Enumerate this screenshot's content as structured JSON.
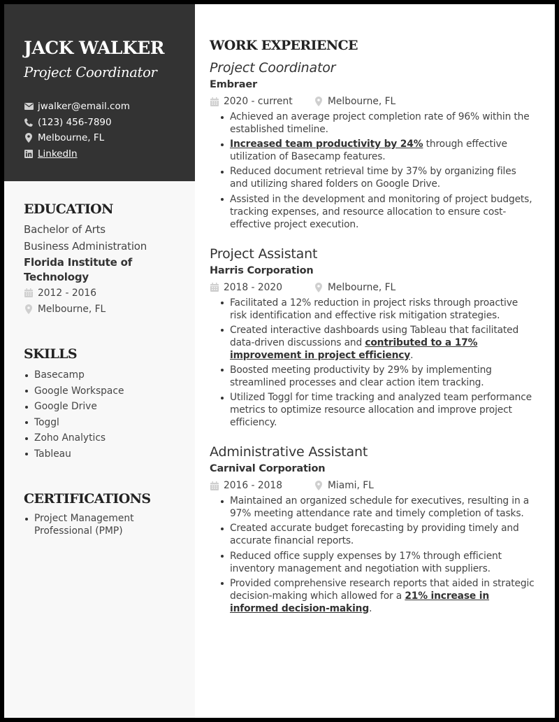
{
  "profile": {
    "name": "JACK WALKER",
    "title": "Project Coordinator",
    "contacts": {
      "email": "jwalker@email.com",
      "phone": "(123) 456-7890",
      "location": "Melbourne, FL",
      "linkedin": "LinkedIn"
    }
  },
  "icons": {
    "email": "envelope-icon",
    "phone": "phone-icon",
    "location": "map-pin-icon",
    "linkedin": "linkedin-icon",
    "calendar": "calendar-icon"
  },
  "colors": {
    "header_bg": "#333333",
    "sidebar_bg": "#f8f8f8",
    "page_border": "#000000",
    "icon_gray": "#c8c8c8"
  },
  "education": {
    "heading": "EDUCATION",
    "degree": "Bachelor of Arts",
    "field": "Business Administration",
    "school": "Florida Institute of Technology",
    "dates": "2012 - 2016",
    "location": "Melbourne, FL"
  },
  "skills": {
    "heading": "SKILLS",
    "items": [
      "Basecamp",
      "Google Workspace",
      "Google Drive",
      "Toggl",
      "Zoho Analytics",
      "Tableau"
    ]
  },
  "certifications": {
    "heading": "CERTIFICATIONS",
    "items": [
      "Project Management Professional (PMP)"
    ]
  },
  "experience": {
    "heading": "WORK EXPERIENCE",
    "jobs": [
      {
        "title": "Project Coordinator",
        "company": "Embraer",
        "dates": "2020 - current",
        "location": "Melbourne, FL",
        "bullets": [
          {
            "pre": "Achieved an average project completion rate of 96% within the established timeline.",
            "bold": "",
            "post": ""
          },
          {
            "pre": "",
            "bold": "Increased team productivity by 24%",
            "post": " through effective utilization of Basecamp features."
          },
          {
            "pre": "Reduced document retrieval time by 37% by organizing files and utilizing shared folders on Google Drive.",
            "bold": "",
            "post": ""
          },
          {
            "pre": "Assisted in the development and monitoring of project budgets, tracking expenses, and resource allocation to ensure cost-effective project execution.",
            "bold": "",
            "post": ""
          }
        ]
      },
      {
        "title": "Project Assistant",
        "company": "Harris Corporation",
        "dates": "2018 - 2020",
        "location": "Melbourne, FL",
        "bullets": [
          {
            "pre": "Facilitated a 12% reduction in project risks through proactive risk identification and effective risk mitigation strategies.",
            "bold": "",
            "post": ""
          },
          {
            "pre": "Created interactive dashboards using Tableau that facilitated data-driven discussions and ",
            "bold": "contributed to a 17% improvement in project efficiency",
            "post": "."
          },
          {
            "pre": "Boosted meeting productivity by 29% by implementing streamlined processes and clear action item tracking.",
            "bold": "",
            "post": ""
          },
          {
            "pre": "Utilized Toggl for time tracking and analyzed team performance metrics to optimize resource allocation and improve project efficiency.",
            "bold": "",
            "post": ""
          }
        ]
      },
      {
        "title": "Administrative Assistant",
        "company": "Carnival Corporation",
        "dates": "2016 - 2018",
        "location": "Miami, FL",
        "bullets": [
          {
            "pre": "Maintained an organized schedule for executives, resulting in a 97% meeting attendance rate and timely completion of tasks.",
            "bold": "",
            "post": ""
          },
          {
            "pre": "Created accurate budget forecasting by providing timely and accurate financial reports.",
            "bold": "",
            "post": ""
          },
          {
            "pre": "Reduced office supply expenses by 17% through efficient inventory management and negotiation with suppliers.",
            "bold": "",
            "post": ""
          },
          {
            "pre": "Provided comprehensive research reports that aided in strategic decision-making which allowed for a ",
            "bold": "21% increase in informed decision-making",
            "post": "."
          }
        ]
      }
    ]
  }
}
